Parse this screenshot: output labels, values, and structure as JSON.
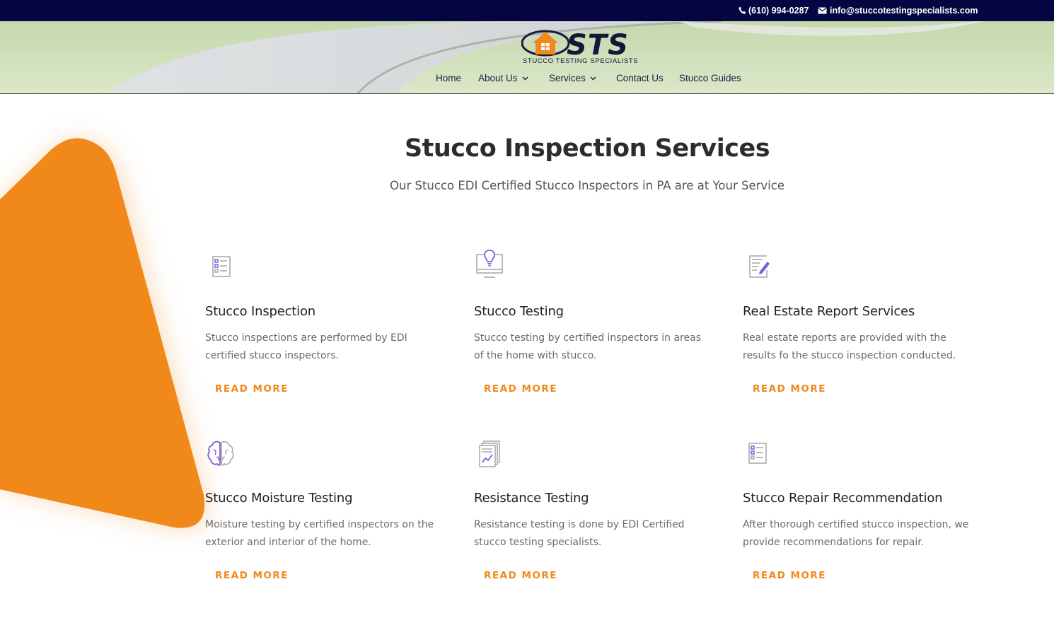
{
  "contact": {
    "phone": "(610) 994-0287",
    "email": "info@stuccotestingspecialists.com"
  },
  "logo": {
    "wordmark": "STS",
    "tagline": "STUCCO TESTING SPECIALISTS"
  },
  "nav": {
    "items": [
      {
        "label": "Home",
        "has_dropdown": false
      },
      {
        "label": "About Us",
        "has_dropdown": true
      },
      {
        "label": "Services",
        "has_dropdown": true
      },
      {
        "label": "Contact Us",
        "has_dropdown": false
      },
      {
        "label": "Stucco Guides",
        "has_dropdown": false
      }
    ]
  },
  "section": {
    "title": "Stucco Inspection Services",
    "subtitle": "Our Stucco EDI Certified Stucco Inspectors in PA are at Your Service"
  },
  "services": [
    {
      "icon": "checklist-icon",
      "title": "Stucco Inspection",
      "desc": "Stucco inspections are performed by EDI certified stucco inspectors.",
      "link": "READ MORE"
    },
    {
      "icon": "lightbulb-monitor-icon",
      "title": "Stucco Testing",
      "desc": "Stucco testing by certified inspectors in areas of the home with stucco.",
      "link": "READ MORE"
    },
    {
      "icon": "report-pen-icon",
      "title": "Real Estate Report Services",
      "desc": "Real estate reports are provided with the results fo the stucco inspection conducted.",
      "link": "READ MORE"
    },
    {
      "icon": "brain-icon",
      "title": "Stucco Moisture Testing",
      "desc": "Moisture testing by certified inspectors on the exterior and interior of the home.",
      "link": "READ MORE"
    },
    {
      "icon": "documents-chart-icon",
      "title": "Resistance Testing",
      "desc": "Resistance testing is done by EDI Certified stucco testing specialists.",
      "link": "READ MORE"
    },
    {
      "icon": "checklist-icon",
      "title": "Stucco Repair Recommendation",
      "desc": "After thorough certified stucco inspection, we provide recommendations for repair.",
      "link": "READ MORE"
    }
  ],
  "colors": {
    "topbar": "#040541",
    "accent": "#f0891a",
    "icon_purple": "#7b5ce0",
    "icon_gray": "#a6a6a6"
  }
}
